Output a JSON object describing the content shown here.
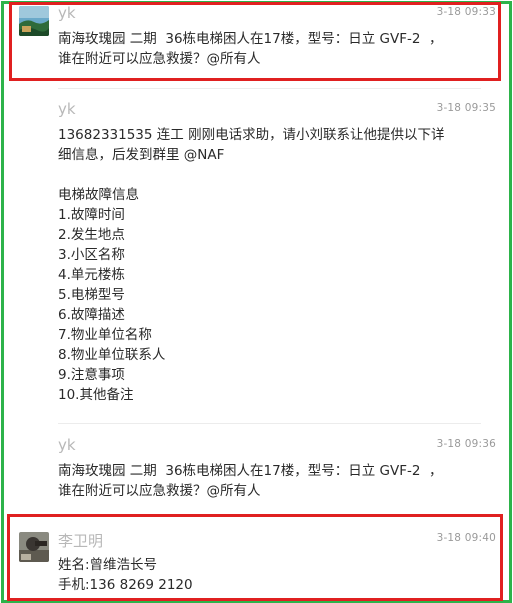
{
  "messages": [
    {
      "sender": "yk",
      "time": "3-18 09:33",
      "lines": [
        "南海玫瑰园 二期  36栋电梯困人在17楼，型号：日立 GVF-2  ，",
        "谁在附近可以应急救援？@所有人"
      ]
    },
    {
      "sender": "yk",
      "time": "3-18 09:35",
      "lines": [
        "13682331535 连工 刚刚电话求助，请小刘联系让他提供以下详",
        "细信息，后发到群里 @NAF",
        "",
        "电梯故障信息",
        "1.故障时间",
        "2.发生地点",
        "3.小区名称",
        "4.单元楼栋",
        "5.电梯型号",
        "6.故障描述",
        "7.物业单位名称",
        "8.物业单位联系人",
        "9.注意事项",
        "10.其他备注"
      ]
    },
    {
      "sender": "yk",
      "time": "3-18 09:36",
      "lines": [
        "南海玫瑰园 二期  36栋电梯困人在17楼，型号：日立 GVF-2  ，",
        "谁在附近可以应急救援？@所有人"
      ]
    },
    {
      "sender": "李卫明",
      "time": "3-18 09:40",
      "lines": [
        "姓名:曾维浩长号",
        "手机:136 8269 2120"
      ]
    }
  ],
  "colors": {
    "frame": "#2db34a",
    "highlight": "#e02020"
  }
}
